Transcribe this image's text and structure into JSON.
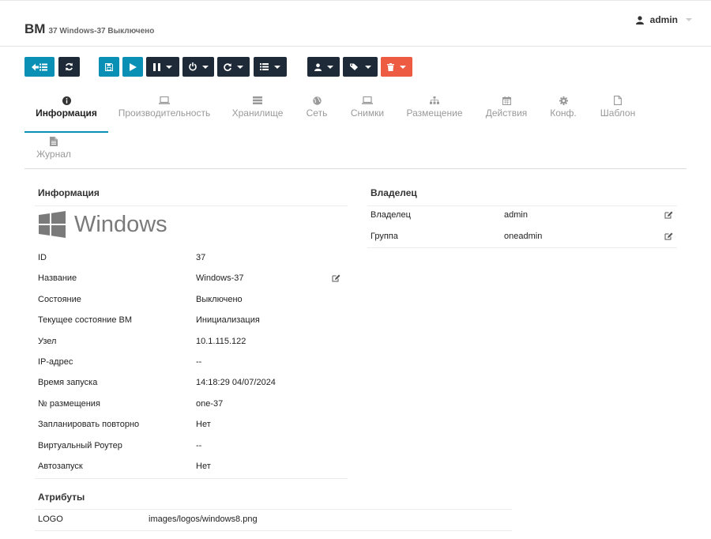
{
  "header": {
    "title": "ВМ",
    "subtitle": "37 Windows-37 Выключено",
    "user": "admin"
  },
  "tabs": [
    {
      "label": "Информация",
      "icon": "info-circle-icon"
    },
    {
      "label": "Производительность",
      "icon": "laptop-icon"
    },
    {
      "label": "Хранилище",
      "icon": "server-icon"
    },
    {
      "label": "Сеть",
      "icon": "globe-icon"
    },
    {
      "label": "Снимки",
      "icon": "laptop-icon"
    },
    {
      "label": "Размещение",
      "icon": "sitemap-icon"
    },
    {
      "label": "Действия",
      "icon": "calendar-icon"
    },
    {
      "label": "Конф.",
      "icon": "gear-icon"
    },
    {
      "label": "Шаблон",
      "icon": "file-icon"
    },
    {
      "label": "Журнал",
      "icon": "file-text-icon"
    }
  ],
  "info": {
    "title": "Информация",
    "logo_text": "Windows",
    "rows": [
      {
        "label": "ID",
        "value": "37"
      },
      {
        "label": "Название",
        "value": "Windows-37"
      },
      {
        "label": "Состояние",
        "value": "Выключено"
      },
      {
        "label": "Текущее состояние ВМ",
        "value": "Инициализация"
      },
      {
        "label": "Узел",
        "value": "10.1.115.122"
      },
      {
        "label": "IP-адрес",
        "value": "--"
      },
      {
        "label": "Время запуска",
        "value": "14:18:29 04/07/2024"
      },
      {
        "label": "№ размещения",
        "value": "one-37"
      },
      {
        "label": "Запланировать повторно",
        "value": "Нет"
      },
      {
        "label": "Виртуальный Роутер",
        "value": "--"
      },
      {
        "label": "Автозапуск",
        "value": "Нет"
      }
    ]
  },
  "owner": {
    "title": "Владелец",
    "rows": [
      {
        "label": "Владелец",
        "value": "admin"
      },
      {
        "label": "Группа",
        "value": "oneadmin"
      }
    ]
  },
  "attributes": {
    "title": "Атрибуты",
    "rows": [
      {
        "label": "LOGO",
        "value": "images/logos/windows8.png"
      }
    ]
  },
  "colors": {
    "accent": "#0a8fb5",
    "dark_button": "#1e2a38",
    "danger": "#ee5b43"
  }
}
